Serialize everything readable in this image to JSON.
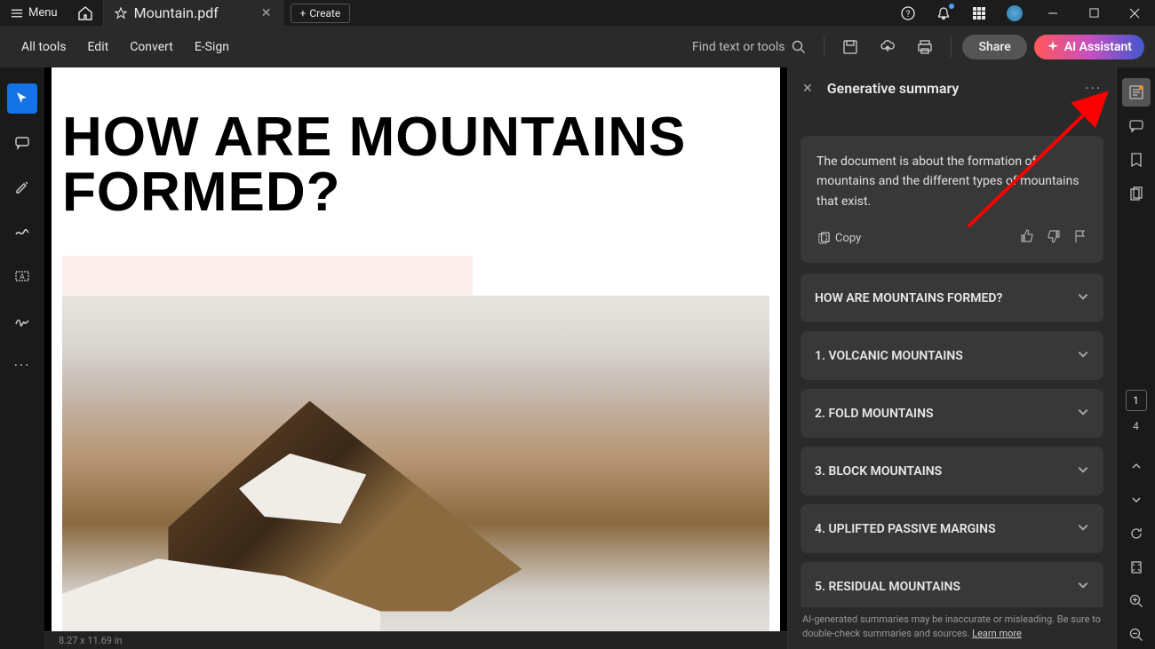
{
  "titlebar": {
    "menu_label": "Menu",
    "tab_name": "Mountain.pdf",
    "create_label": "Create"
  },
  "toolbar": {
    "all_tools": "All tools",
    "edit": "Edit",
    "convert": "Convert",
    "esign": "E-Sign",
    "search_placeholder": "Find text or tools",
    "share": "Share",
    "ai_assistant": "AI Assistant"
  },
  "document": {
    "heading": "HOW ARE MOUNTAINS FORMED?",
    "page_size": "8.27 x 11.69 in"
  },
  "summary_panel": {
    "title": "Generative summary",
    "summary_text": "The document is about the formation of mountains and the different types of mountains that exist.",
    "copy_label": "Copy",
    "sections": [
      "HOW ARE MOUNTAINS FORMED?",
      "1. VOLCANIC MOUNTAINS",
      "2. FOLD MOUNTAINS",
      "3. BLOCK MOUNTAINS",
      "4. UPLIFTED PASSIVE MARGINS",
      "5. RESIDUAL MOUNTAINS"
    ],
    "disclaimer_text": "AI-generated summaries may be inaccurate or misleading. Be sure to double-check summaries and sources. ",
    "learn_more": "Learn more"
  },
  "pagination": {
    "current": "1",
    "total": "4"
  }
}
